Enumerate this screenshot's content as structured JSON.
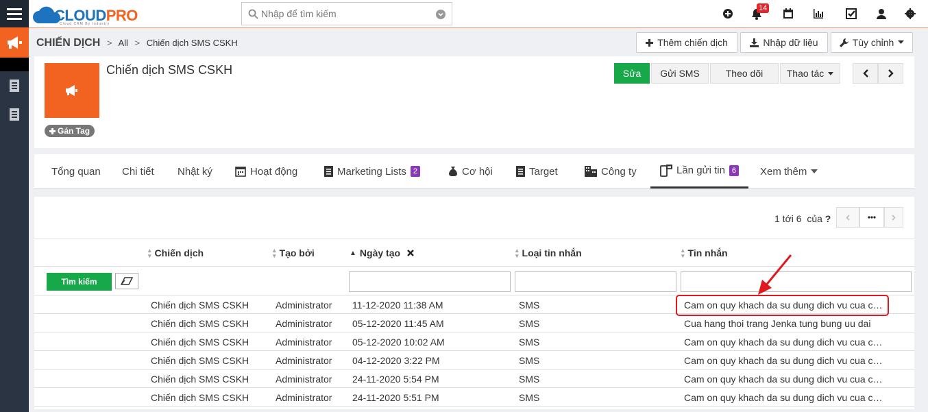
{
  "colors": {
    "accent": "#f26322",
    "primary": "#17a84a",
    "brand_blue": "#1e73be",
    "badge_purple": "#8a3ab9",
    "badge_red": "#e5252a"
  },
  "logo": {
    "part1": "CLOUD",
    "part2": "PRO",
    "tagline": "Cloud CRM By Industry"
  },
  "search": {
    "placeholder": "Nhập để tìm kiếm"
  },
  "topbar": {
    "notification_count": "14"
  },
  "breadcrumb": {
    "module": "CHIẾN DỊCH",
    "sep1": ">",
    "filter": "All",
    "sep2": ">",
    "record": "Chiến dịch SMS CSKH"
  },
  "header_buttons": {
    "add": "Thêm chiến dịch",
    "import": "Nhập dữ liệu",
    "customize": "Tùy chỉnh"
  },
  "record": {
    "title": "Chiến dịch SMS CSKH",
    "tag_button": "Gán Tag"
  },
  "actions": {
    "edit": "Sửa",
    "send_sms": "Gửi SMS",
    "follow": "Theo dõi",
    "more": "Thao tác"
  },
  "tabs": [
    {
      "label": "Tổng quan"
    },
    {
      "label": "Chi tiết"
    },
    {
      "label": "Nhật ký"
    },
    {
      "label": "Hoạt động"
    },
    {
      "label": "Marketing Lists",
      "count": "2"
    },
    {
      "label": "Cơ hội"
    },
    {
      "label": "Target"
    },
    {
      "label": "Công ty"
    },
    {
      "label": "Lần gửi tin",
      "count": "6"
    },
    {
      "label": "Xem thêm"
    }
  ],
  "pager": {
    "range": "1 tới 6",
    "of": "của",
    "total": "?"
  },
  "table": {
    "columns": [
      "Chiến dịch",
      "Tạo bởi",
      "Ngày tạo",
      "Loại tin nhắn",
      "Tin nhắn"
    ],
    "search_button": "Tìm kiếm",
    "rows": [
      [
        "Chiến dịch SMS CSKH",
        "Administrator",
        "11-12-2020 11:38 AM",
        "SMS",
        "Cam on quy khach da su dung dich vu cua chung toi"
      ],
      [
        "Chiến dịch SMS CSKH",
        "Administrator",
        "05-12-2020 11:45 AM",
        "SMS",
        "Cua hang thoi trang Jenka tung bung uu dai"
      ],
      [
        "Chiến dịch SMS CSKH",
        "Administrator",
        "05-12-2020 10:02 AM",
        "SMS",
        "Cam on quy khach da su dung dich vu cua chung toi"
      ],
      [
        "Chiến dịch SMS CSKH",
        "Administrator",
        "04-12-2020 3:22 PM",
        "SMS",
        "Cam on quy khach da su dung dich vu cua chung toi"
      ],
      [
        "Chiến dịch SMS CSKH",
        "Administrator",
        "24-11-2020 5:54 PM",
        "SMS",
        "Cam on quy khach da su dung dich vu cua chung toi"
      ],
      [
        "Chiến dịch SMS CSKH",
        "Administrator",
        "24-11-2020 5:51 PM",
        "SMS",
        "Cam on quy khach da su dung dich vu cua chung toi"
      ]
    ]
  }
}
